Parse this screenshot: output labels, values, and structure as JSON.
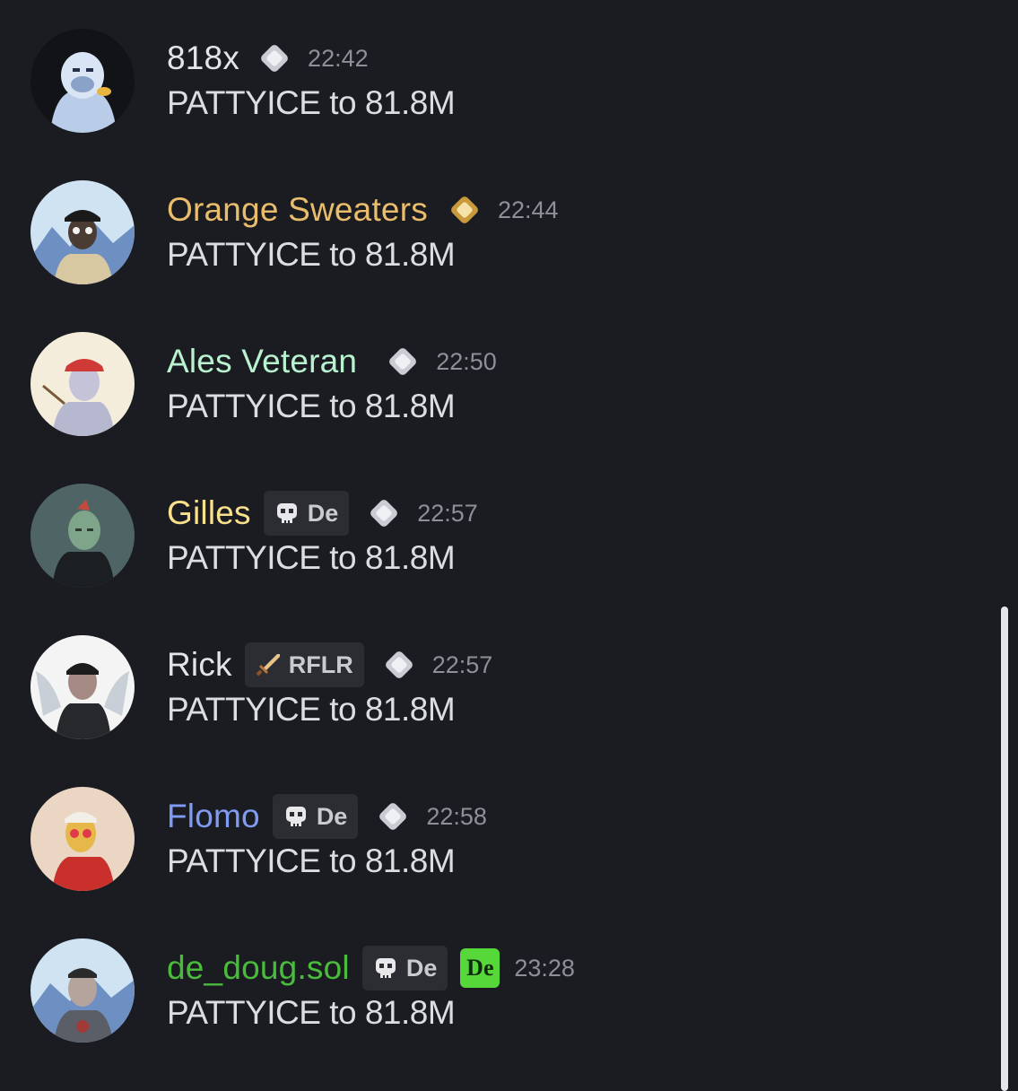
{
  "colors": {
    "background": "#1b1c21",
    "message_text": "#dcdde1",
    "timestamp": "#8e9098",
    "tag_background": "#2b2d33"
  },
  "messages": [
    {
      "username": "818x",
      "username_color": "#e3e4e8",
      "timestamp": "22:42",
      "role_tag": null,
      "badge_icon": "silver-diamond-icon",
      "text": "PATTYICE to 81.8M"
    },
    {
      "username": "Orange Sweaters",
      "username_color": "#e9bd6b",
      "timestamp": "22:44",
      "role_tag": null,
      "badge_icon": "gold-diamond-icon",
      "text": "PATTYICE to 81.8M"
    },
    {
      "username": "Ales Veteran",
      "username_color": "#b9f2cf",
      "timestamp": "22:50",
      "role_tag": null,
      "badge_icon": "silver-diamond-icon",
      "text": "PATTYICE to 81.8M"
    },
    {
      "username": "Gilles",
      "username_color": "#f9e08a",
      "timestamp": "22:57",
      "role_tag": {
        "icon": "skull-icon",
        "label": "De"
      },
      "badge_icon": "silver-diamond-icon",
      "text": "PATTYICE to 81.8M"
    },
    {
      "username": "Rick",
      "username_color": "#e3e4e8",
      "timestamp": "22:57",
      "role_tag": {
        "icon": "sword-icon",
        "label": "RFLR"
      },
      "badge_icon": "silver-diamond-icon",
      "text": "PATTYICE to 81.8M"
    },
    {
      "username": "Flomo",
      "username_color": "#7f9bf2",
      "timestamp": "22:58",
      "role_tag": {
        "icon": "skull-icon",
        "label": "De"
      },
      "badge_icon": "silver-diamond-icon",
      "text": "PATTYICE to 81.8M"
    },
    {
      "username": "de_doug.sol",
      "username_color": "#49bc3c",
      "timestamp": "23:28",
      "role_tag": {
        "icon": "skull-icon",
        "label": "De"
      },
      "badge_icon": "de-logo-badge",
      "badge_label": "De",
      "text": "PATTYICE to 81.8M"
    }
  ]
}
